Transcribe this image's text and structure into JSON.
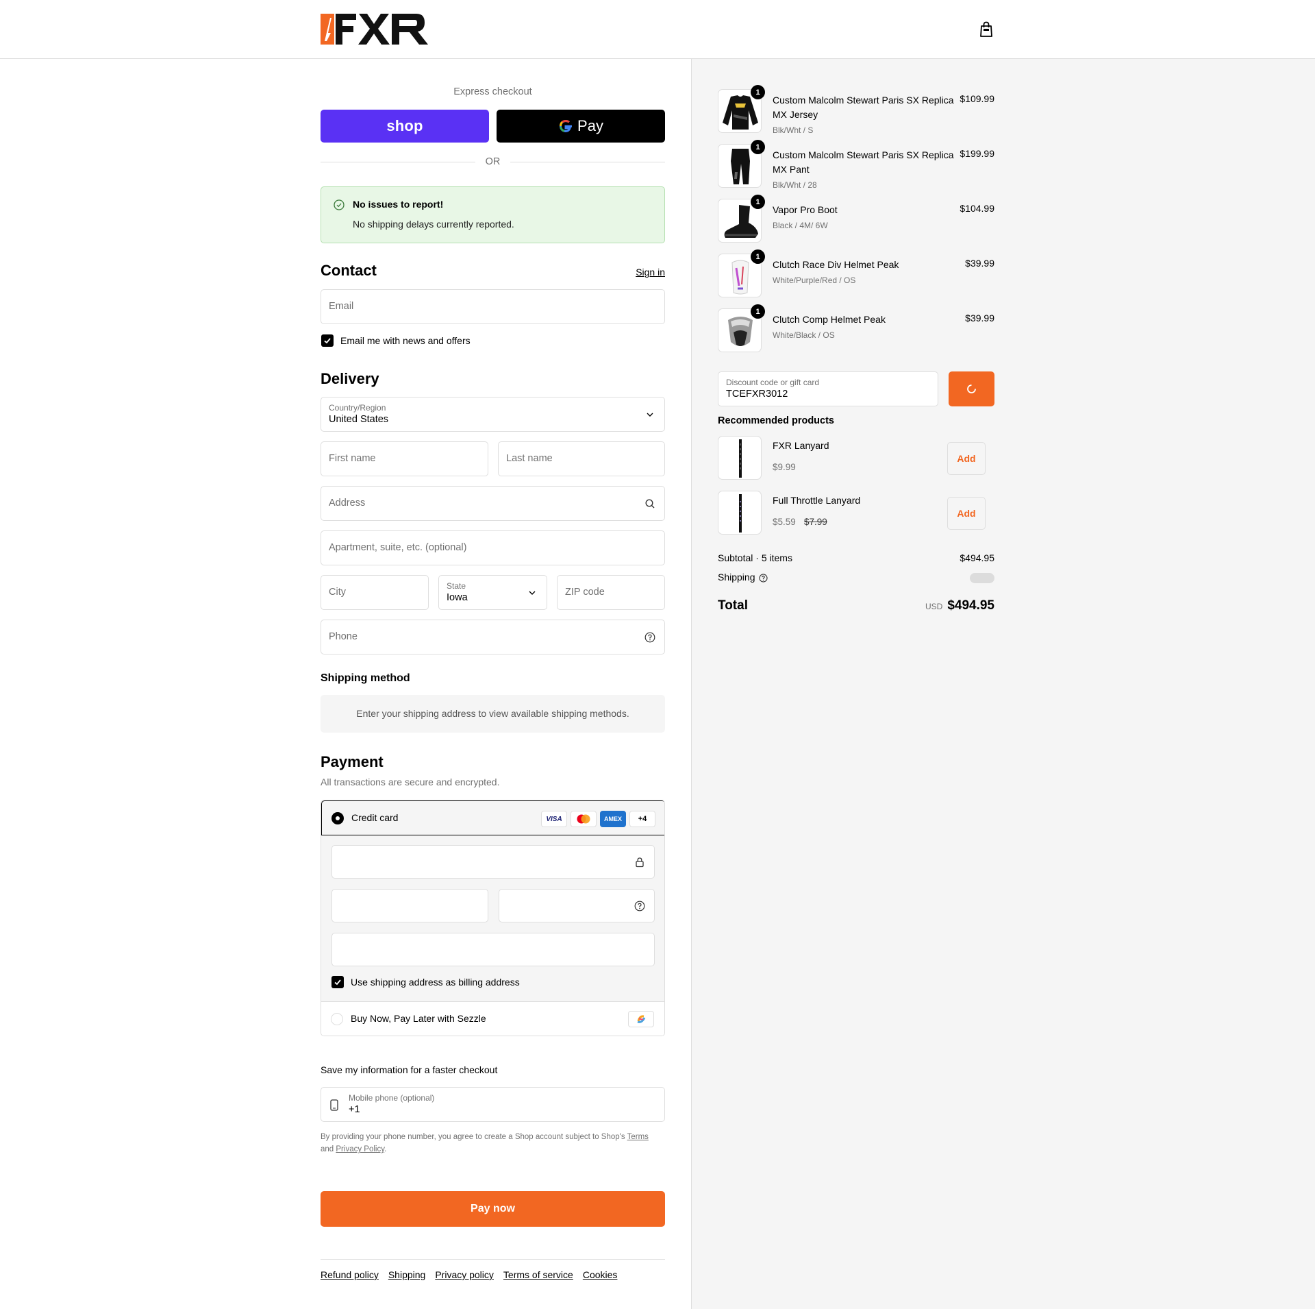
{
  "colors": {
    "accent": "#f26722",
    "shop": "#5a31f4",
    "notice_bg": "#e8f7e6"
  },
  "express": {
    "label": "Express checkout",
    "shop_label": "shop",
    "gpay_label": "Pay",
    "or_label": "OR"
  },
  "notice": {
    "title": "No issues to report!",
    "text": "No shipping delays currently reported."
  },
  "contact": {
    "heading": "Contact",
    "sign_in": "Sign in",
    "email_placeholder": "Email",
    "news_label": "Email me with news and offers",
    "news_checked": true
  },
  "delivery": {
    "heading": "Delivery",
    "country_label": "Country/Region",
    "country_value": "United States",
    "first_name": "First name",
    "last_name": "Last name",
    "address": "Address",
    "apartment": "Apartment, suite, etc. (optional)",
    "city": "City",
    "state_label": "State",
    "state_value": "Iowa",
    "zip": "ZIP code",
    "phone": "Phone"
  },
  "shipping_method": {
    "heading": "Shipping method",
    "text": "Enter your shipping address to view available shipping methods."
  },
  "payment": {
    "heading": "Payment",
    "subtitle": "All transactions are secure and encrypted.",
    "credit_card": "Credit card",
    "cards": [
      "VISA",
      "mastercard",
      "AMEX"
    ],
    "more_cards": "+4",
    "billing_label": "Use shipping address as billing address",
    "sezzle": "Buy Now, Pay Later with Sezzle"
  },
  "save_info": {
    "heading": "Save my information for a faster checkout",
    "mobile_label": "Mobile phone (optional)",
    "mobile_value": "+1",
    "legal_1": "By providing your phone number, you agree to create a Shop account subject to Shop's",
    "terms": "Terms",
    "legal_and": "and",
    "privacy": "Privacy Policy",
    "legal_end": "."
  },
  "pay_now": "Pay now",
  "footer": [
    "Refund policy",
    "Shipping",
    "Privacy policy",
    "Terms of service",
    "Cookies"
  ],
  "cart": {
    "items": [
      {
        "name": "Custom Malcolm Stewart Paris SX Replica MX Jersey",
        "variant": "Blk/Wht / S",
        "price": "$109.99",
        "qty": "1"
      },
      {
        "name": "Custom Malcolm Stewart Paris SX Replica MX Pant",
        "variant": "Blk/Wht / 28",
        "price": "$199.99",
        "qty": "1"
      },
      {
        "name": "Vapor Pro Boot",
        "variant": "Black / 4M/ 6W",
        "price": "$104.99",
        "qty": "1"
      },
      {
        "name": "Clutch Race Div Helmet Peak",
        "variant": "White/Purple/Red / OS",
        "price": "$39.99",
        "qty": "1"
      },
      {
        "name": "Clutch Comp Helmet Peak",
        "variant": "White/Black / OS",
        "price": "$39.99",
        "qty": "1"
      }
    ],
    "discount_label": "Discount code or gift card",
    "discount_value": "TCEFXR3012",
    "recommended_heading": "Recommended products",
    "recommended": [
      {
        "name": "FXR Lanyard",
        "price": "$9.99",
        "old_price": "",
        "add": "Add"
      },
      {
        "name": "Full Throttle Lanyard",
        "price": "$5.59",
        "old_price": "$7.99",
        "add": "Add"
      }
    ],
    "subtotal_label": "Subtotal · 5 items",
    "subtotal_value": "$494.95",
    "shipping_label": "Shipping",
    "total_label": "Total",
    "currency": "USD",
    "total_value": "$494.95"
  }
}
